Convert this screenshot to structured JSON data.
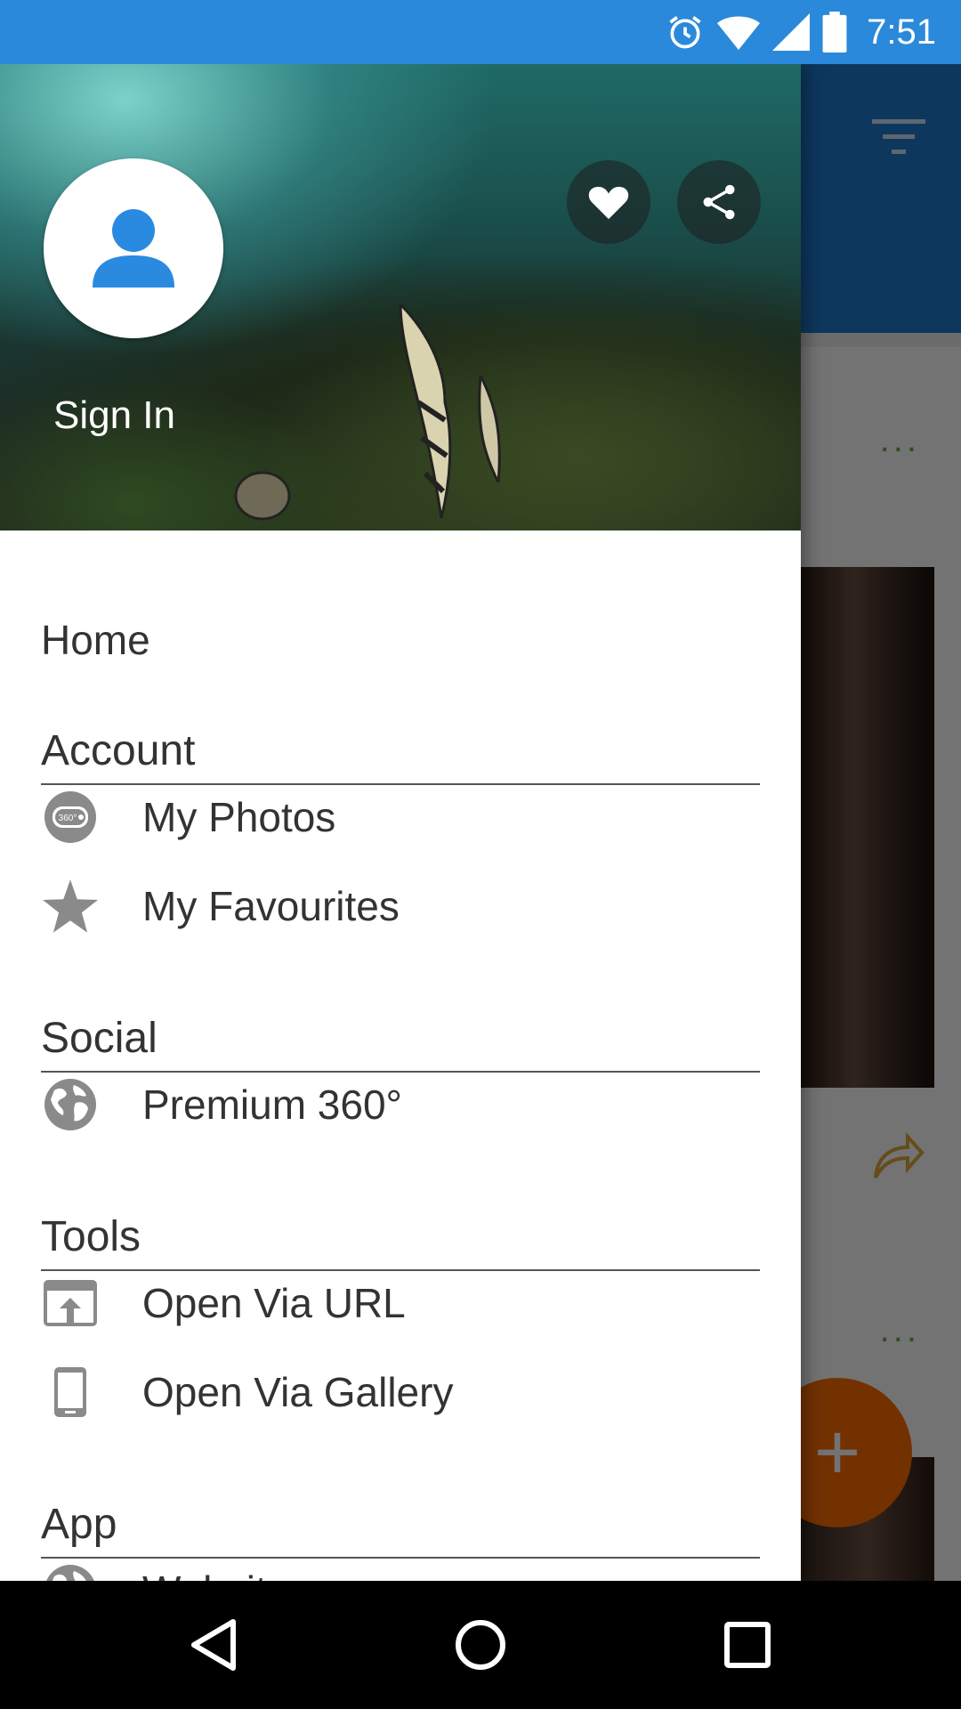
{
  "status_bar": {
    "time": "7:51",
    "icons": [
      "alarm-icon",
      "wifi-icon",
      "signal-icon",
      "battery-icon"
    ]
  },
  "drawer": {
    "header": {
      "sign_in_label": "Sign In",
      "favourite_icon": "heart-icon",
      "share_icon": "share-icon",
      "avatar_icon": "person-icon"
    },
    "home_label": "Home",
    "sections": [
      {
        "title": "Account",
        "items": [
          {
            "label": "My Photos",
            "icon": "360-camera-icon"
          },
          {
            "label": "My Favourites",
            "icon": "star-icon"
          }
        ]
      },
      {
        "title": "Social",
        "items": [
          {
            "label": "Premium 360°",
            "icon": "globe-icon"
          }
        ]
      },
      {
        "title": "Tools",
        "items": [
          {
            "label": "Open Via URL",
            "icon": "upload-window-icon"
          },
          {
            "label": "Open Via Gallery",
            "icon": "phone-icon"
          }
        ]
      },
      {
        "title": "App",
        "items": [
          {
            "label": "Website",
            "icon": "globe-icon"
          }
        ]
      }
    ]
  },
  "background": {
    "fab_label": "+",
    "more_dots": "...",
    "accent_color": "#ff6d00",
    "toolbar_color": "#1f7bd0"
  },
  "nav_bar": {
    "buttons": [
      "back-icon",
      "home-icon",
      "recents-icon"
    ]
  }
}
